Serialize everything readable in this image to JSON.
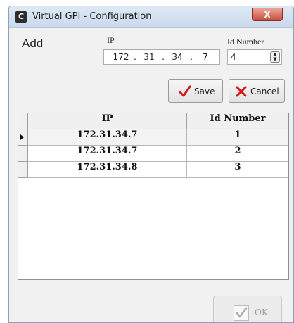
{
  "window": {
    "app_icon_letter": "C",
    "title": "Virtual GPI - Configuration",
    "close_symbol": "X"
  },
  "form": {
    "heading": "Add",
    "ip_label": "IP",
    "ip_octets": [
      "172",
      "31",
      "34",
      "7"
    ],
    "ip_separator": ".",
    "id_label": "Id Number",
    "id_value": "4",
    "save_label": "Save",
    "cancel_label": "Cancel"
  },
  "table": {
    "columns": [
      "IP",
      "Id Number"
    ],
    "rows": [
      {
        "ip": "172.31.34.7",
        "id": "1",
        "selected": true
      },
      {
        "ip": "172.31.34.7",
        "id": "2",
        "selected": false
      },
      {
        "ip": "172.31.34.8",
        "id": "3",
        "selected": false
      }
    ]
  },
  "footer": {
    "ok_label": "OK",
    "ok_enabled": false
  },
  "icons": {
    "save": "checkmark-icon",
    "cancel": "x-mark-icon",
    "ok": "checkbox-check-icon",
    "row_indicator": "current-row-arrow-icon"
  },
  "colors": {
    "save_check": "#d11a1a",
    "cancel_x": "#d11a1a",
    "close_button": "#c7503b"
  }
}
